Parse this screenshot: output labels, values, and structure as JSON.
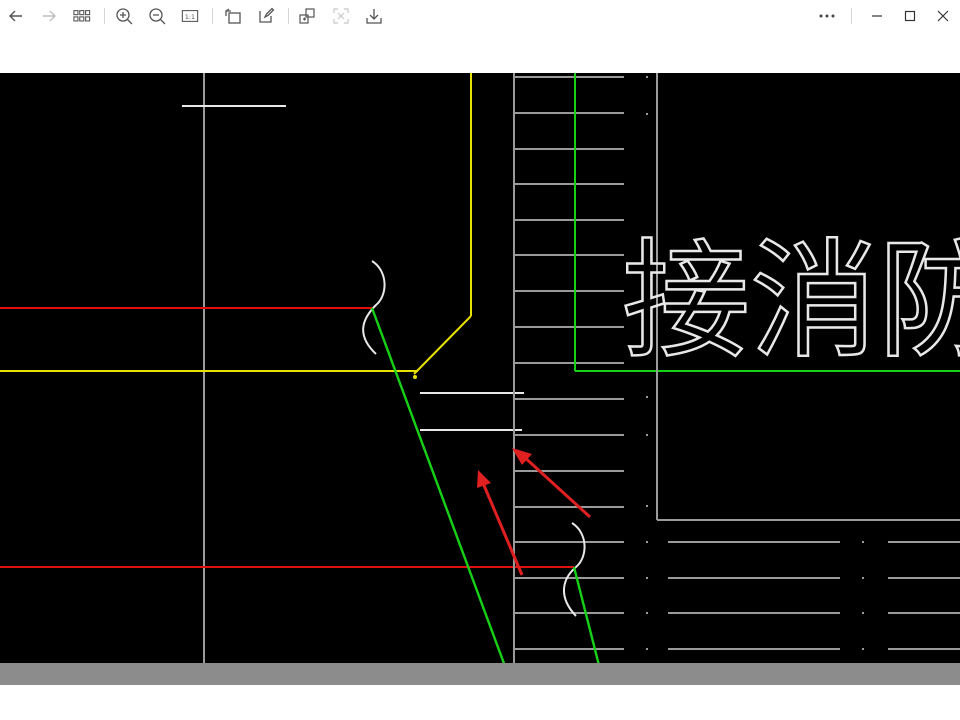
{
  "toolbar": {
    "back": "back-icon",
    "forward": "forward-icon",
    "grid": "thumbnails-icon",
    "zoom_in": "zoom-in-icon",
    "zoom_out": "zoom-out-icon",
    "actual_size": "1:1",
    "rotate": "rotate-icon",
    "edit": "edit-icon",
    "share": "share-icon",
    "fullscreen": "fullscreen-icon",
    "save": "save-icon",
    "more": "more-icon",
    "minimize": "minimize-icon",
    "maximize": "maximize-icon",
    "close": "close-icon"
  },
  "drawing": {
    "label_text": "接消防",
    "colors": {
      "background": "#000000",
      "red": "#e01010",
      "yellow": "#e8e000",
      "green": "#17d117",
      "white": "#e8e8e8",
      "grey": "#9a9a9a",
      "arrow": "#e02020"
    }
  }
}
